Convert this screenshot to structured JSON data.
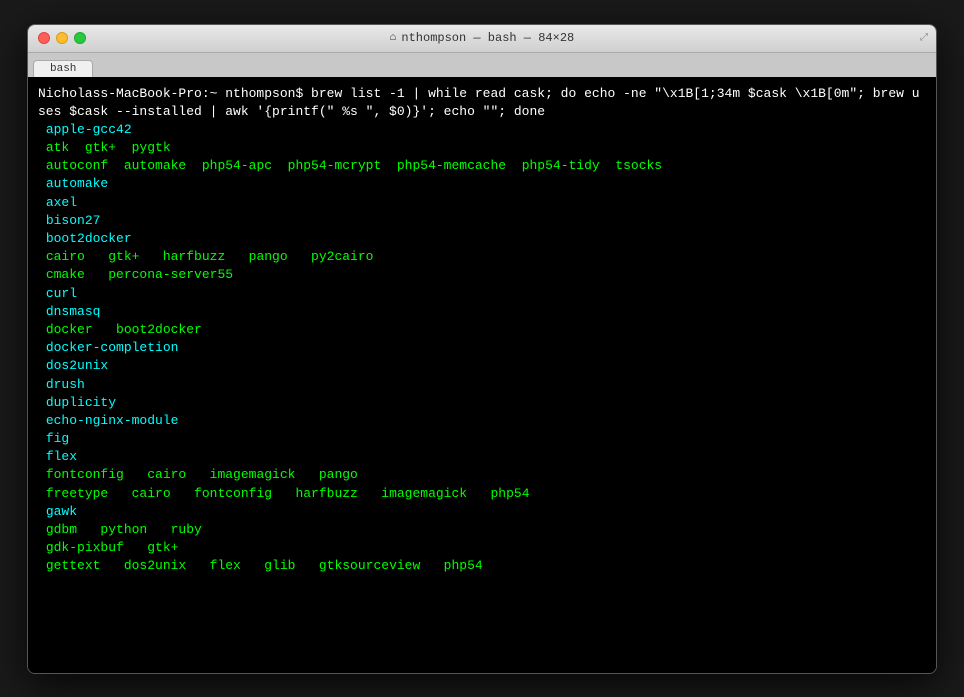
{
  "window": {
    "title": "nthompson — bash — 84×28",
    "tab_label": "bash"
  },
  "traffic_lights": {
    "close": "close",
    "minimize": "minimize",
    "maximize": "maximize"
  },
  "terminal": {
    "lines": [
      {
        "text": "Nicholass-MacBook-Pro:~ nthompson$ brew list -1 | while read cask; do echo -ne \"\\x1B[1;34m $cask \\x1B[0m\"; brew uses $cask --installed | awk '{printf(\" %s \", $0)}'; echo \"\"; done",
        "color": "white"
      },
      {
        "text": " apple-gcc42",
        "color": "cyan"
      },
      {
        "text": " atk  gtk+  pygtk",
        "color": "green"
      },
      {
        "text": " autoconf  automake  php54-apc  php54-mcrypt  php54-memcache  php54-tidy  tsocks",
        "color": "green"
      },
      {
        "text": " automake",
        "color": "cyan"
      },
      {
        "text": " axel",
        "color": "cyan"
      },
      {
        "text": " bison27",
        "color": "cyan"
      },
      {
        "text": " boot2docker",
        "color": "cyan"
      },
      {
        "text": " cairo   gtk+   harfbuzz   pango   py2cairo",
        "color": "green"
      },
      {
        "text": " cmake   percona-server55",
        "color": "green"
      },
      {
        "text": " curl",
        "color": "cyan"
      },
      {
        "text": " dnsmasq",
        "color": "cyan"
      },
      {
        "text": " docker   boot2docker",
        "color": "green"
      },
      {
        "text": " docker-completion",
        "color": "cyan"
      },
      {
        "text": " dos2unix",
        "color": "cyan"
      },
      {
        "text": " drush",
        "color": "cyan"
      },
      {
        "text": " duplicity",
        "color": "cyan"
      },
      {
        "text": " echo-nginx-module",
        "color": "cyan"
      },
      {
        "text": " fig",
        "color": "cyan"
      },
      {
        "text": " flex",
        "color": "cyan"
      },
      {
        "text": " fontconfig   cairo   imagemagick   pango",
        "color": "green"
      },
      {
        "text": " freetype   cairo   fontconfig   harfbuzz   imagemagick   php54",
        "color": "green"
      },
      {
        "text": " gawk",
        "color": "cyan"
      },
      {
        "text": " gdbm   python   ruby",
        "color": "green"
      },
      {
        "text": " gdk-pixbuf   gtk+",
        "color": "green"
      },
      {
        "text": " gettext   dos2unix   flex   glib   gtksourceview   php54",
        "color": "green"
      }
    ]
  }
}
